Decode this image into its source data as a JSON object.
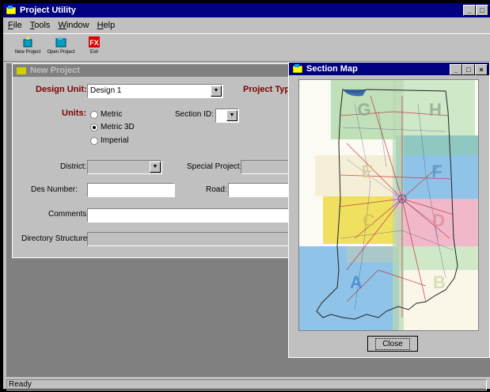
{
  "app": {
    "title": "Project Utility"
  },
  "menu": {
    "items": [
      "File",
      "Tools",
      "Window",
      "Help"
    ]
  },
  "toolbar": {
    "new_project": "New Project",
    "open_project": "Open Project",
    "exit": "Exit",
    "exit_icon_text": "FX"
  },
  "new_project": {
    "title": "New Project",
    "design_unit_label": "Design Unit:",
    "design_unit_value": "Design 1",
    "project_type_label": "Project Type",
    "units_label": "Units:",
    "units_options": [
      "Metric",
      "Metric 3D",
      "Imperial"
    ],
    "units_selected": "Metric 3D",
    "section_id_label": "Section ID:",
    "section_id_value": "",
    "district_label": "District:",
    "district_value": "",
    "special_project_label": "Special Project:",
    "des_number_label": "Des Number:",
    "des_number_value": "",
    "road_label": "Road:",
    "road_value": "",
    "comments_label": "Comments:",
    "comments_value": "",
    "directory_label": "Directory Structure:",
    "directory_value": ""
  },
  "section_map": {
    "title": "Section Map",
    "sections": [
      "G",
      "H",
      "E",
      "F",
      "C",
      "D",
      "A",
      "B"
    ],
    "close_label": "Close"
  },
  "status": {
    "text": "Ready"
  },
  "colors": {
    "title_active": "#000080",
    "title_inactive": "#808080",
    "label_red": "#800000",
    "section_green": "#bfe0b8",
    "section_blue": "#8fc4e8",
    "section_yellow": "#f0e060",
    "section_red": "#f0b8c8"
  }
}
